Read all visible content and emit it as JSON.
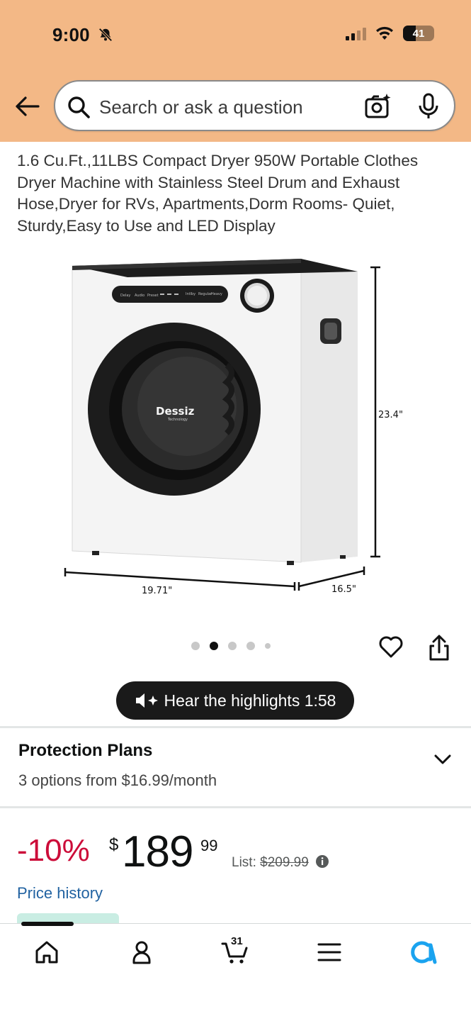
{
  "status_bar": {
    "time": "9:00",
    "battery": "41",
    "battery_level": 0.41
  },
  "search": {
    "placeholder": "Search or ask a question"
  },
  "product": {
    "title": "1.6 Cu.Ft.,11LBS Compact Dryer 950W Portable Clothes Dryer Machine with Stainless Steel Drum and Exhaust Hose,Dryer for RVs, Apartments,Dorm Rooms- Quiet, Sturdy,Easy to Use and LED Display",
    "image": {
      "brand": "Dessiz",
      "brand_sub": "Technology",
      "height_label": "23.4\"",
      "width_label": "19.71\"",
      "depth_label": "16.5\"",
      "panel_labels": [
        "Delay",
        "Audio",
        "Preset",
        "Intlby",
        "Regular",
        "Heavy"
      ]
    },
    "carousel": {
      "count": 5,
      "active": 2
    }
  },
  "hear_highlights": {
    "label": "Hear the highlights 1:58"
  },
  "protection": {
    "title": "Protection Plans",
    "subtitle": "3 options from $16.99/month"
  },
  "price": {
    "discount": "-10%",
    "symbol": "$",
    "whole": "189",
    "fraction": "99",
    "list_label": "List:",
    "list_value": "$209.99"
  },
  "price_history": {
    "label": "Price history"
  },
  "bottom_nav": {
    "cart_count": "31"
  },
  "colors": {
    "header": "#f3b886",
    "deal_red": "#cc0c39",
    "link_blue": "#2162a1",
    "alexa_blue": "#1aa3ef"
  }
}
